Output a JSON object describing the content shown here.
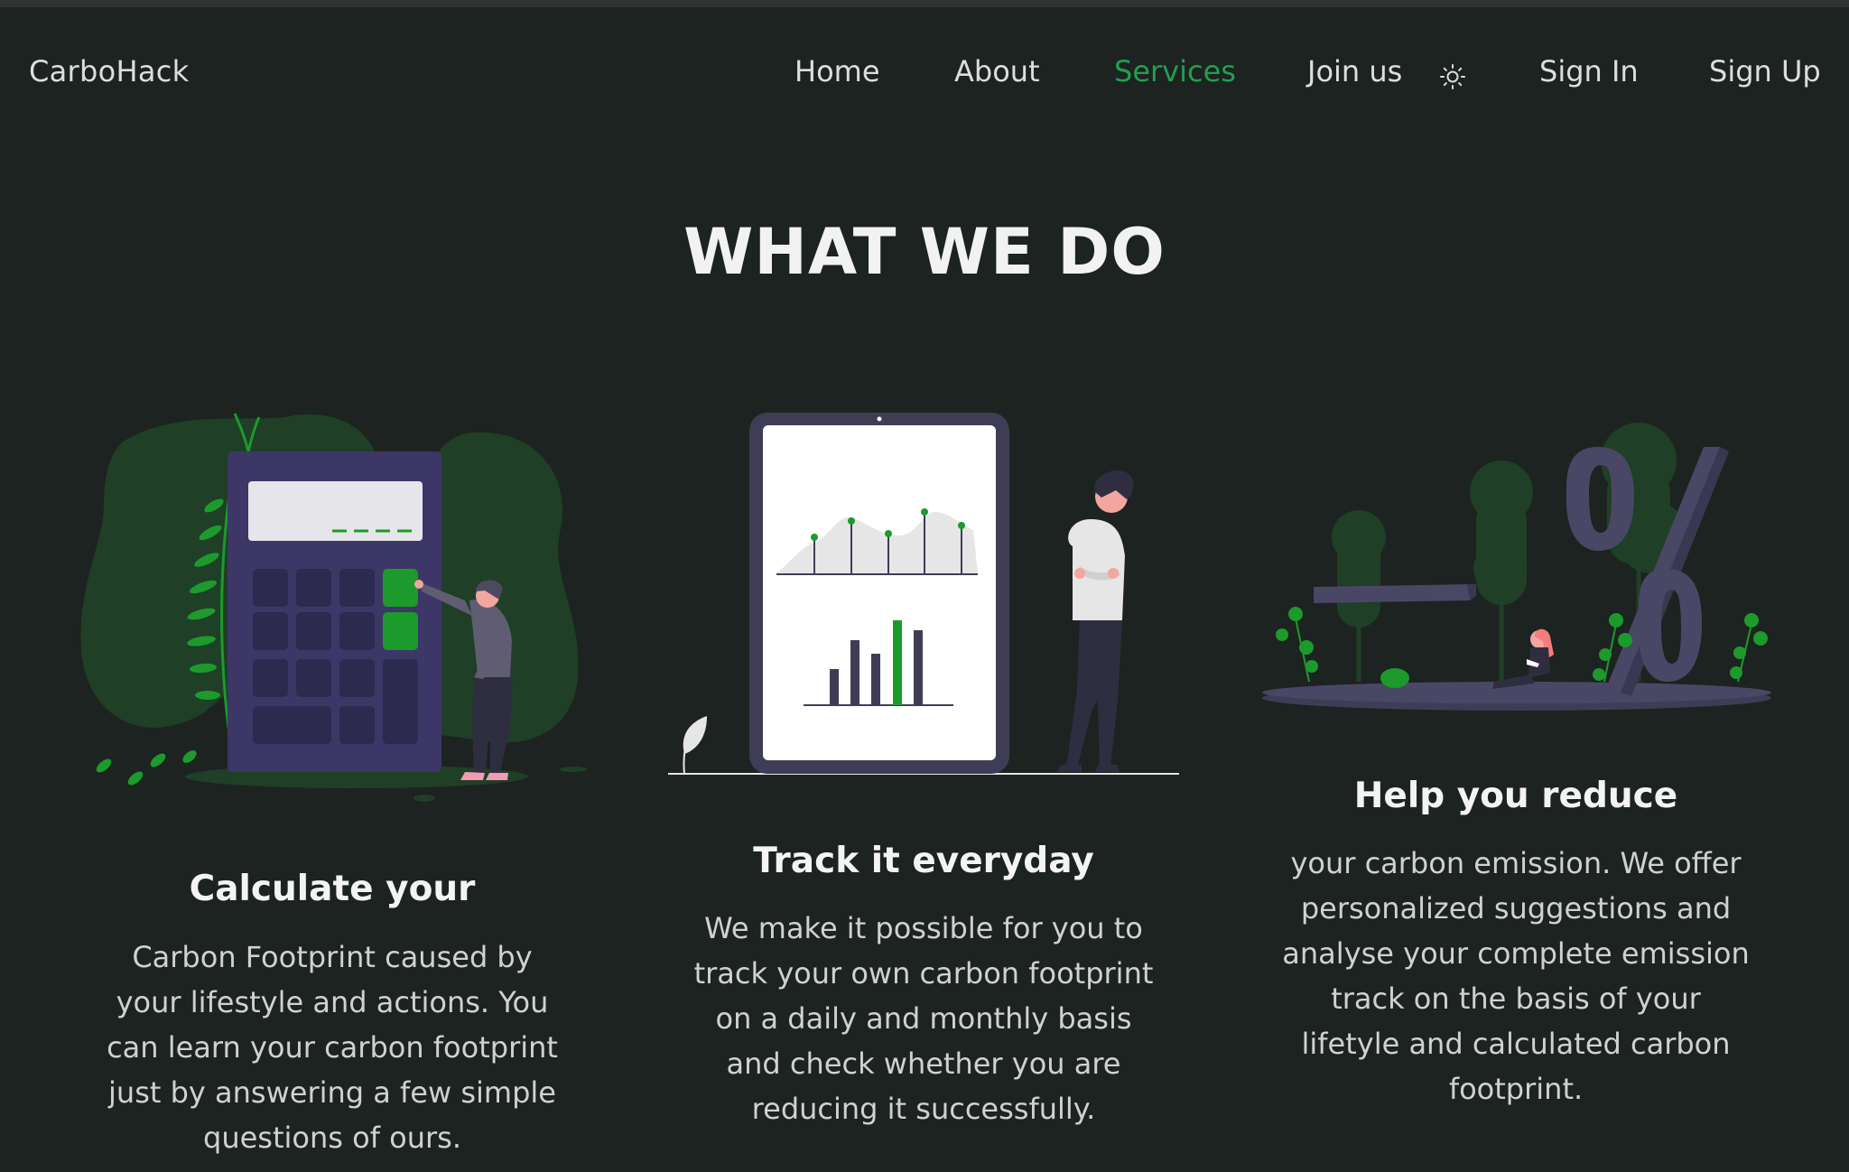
{
  "brand": "CarboHack",
  "nav": {
    "home": "Home",
    "about": "About",
    "services": "Services",
    "join": "Join us",
    "signin": "Sign In",
    "signup": "Sign Up",
    "theme_icon": "sun-icon"
  },
  "section_title": "WHAT WE DO",
  "cards": [
    {
      "title": "Calculate your",
      "text": "Carbon Footprint caused by your lifestyle and actions. You can learn your carbon footprint just by answering a few simple questions of ours."
    },
    {
      "title": "Track it everyday",
      "text": "We make it possible for you to track your own carbon footprint on a daily and monthly basis and check whether you are reducing it successfully."
    },
    {
      "title": "Help you reduce",
      "text": "your carbon emission. We offer personalized suggestions and analyse your complete emission track on the basis of your lifetyle and calculated carbon footprint."
    }
  ],
  "colors": {
    "background": "#1d2320",
    "accent": "#1fa04f",
    "illustration_purple": "#3f3d56"
  }
}
